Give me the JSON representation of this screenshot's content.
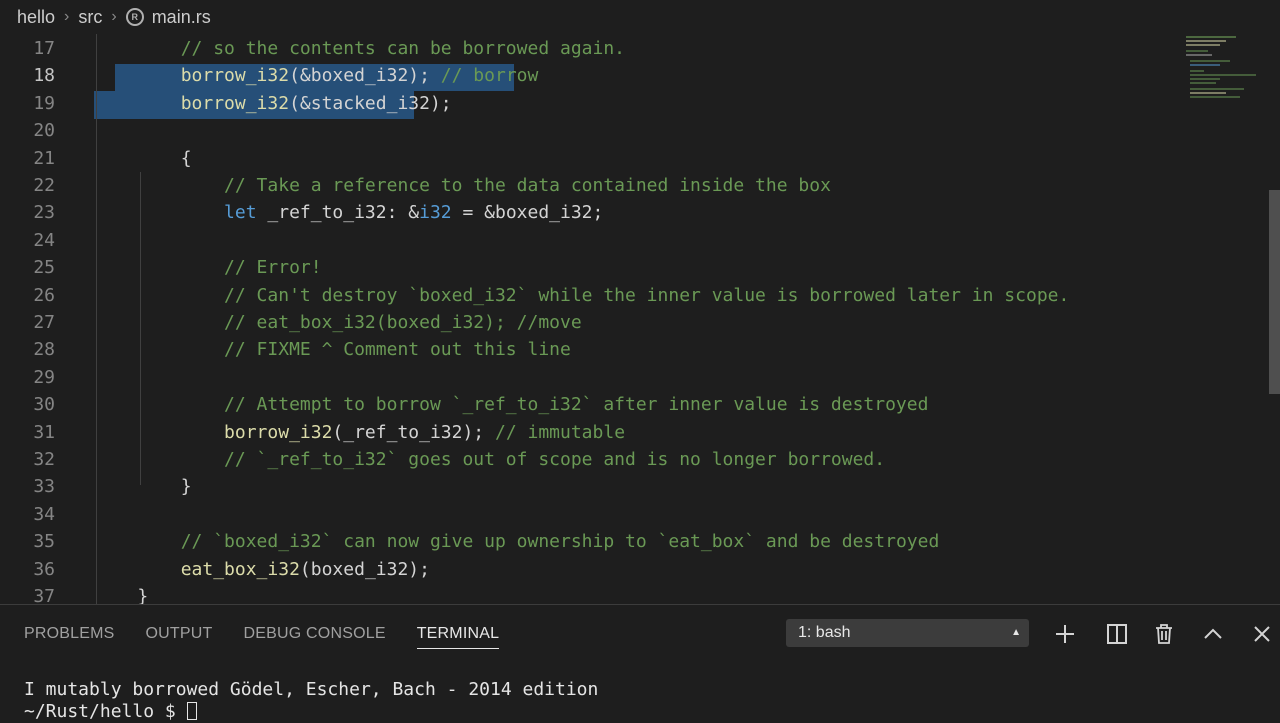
{
  "breadcrumb": {
    "items": [
      "hello",
      "src",
      "main.rs"
    ],
    "file_icon": "rust-file-icon"
  },
  "editor": {
    "active_line": "18",
    "lines": [
      {
        "num": "17",
        "tokens": [
          {
            "t": "        "
          },
          {
            "t": "// so the contents can be borrowed again.",
            "c": "comment"
          }
        ]
      },
      {
        "num": "18",
        "tokens": [
          {
            "t": "        "
          },
          {
            "t": "borrow_i32",
            "c": "fn"
          },
          {
            "t": "(&boxed_i32); "
          },
          {
            "t": "// borrow",
            "c": "comment"
          }
        ]
      },
      {
        "num": "19",
        "tokens": [
          {
            "t": "        "
          },
          {
            "t": "borrow_i32",
            "c": "fn"
          },
          {
            "t": "(&stacked_i32);"
          }
        ]
      },
      {
        "num": "20",
        "tokens": []
      },
      {
        "num": "21",
        "tokens": [
          {
            "t": "        {"
          }
        ]
      },
      {
        "num": "22",
        "tokens": [
          {
            "t": "            "
          },
          {
            "t": "// Take a reference to the data contained inside the box",
            "c": "comment"
          }
        ]
      },
      {
        "num": "23",
        "tokens": [
          {
            "t": "            "
          },
          {
            "t": "let",
            "c": "keyword"
          },
          {
            "t": " _ref_to_i32: &"
          },
          {
            "t": "i32",
            "c": "keyword"
          },
          {
            "t": " = &boxed_i32;"
          }
        ]
      },
      {
        "num": "24",
        "tokens": []
      },
      {
        "num": "25",
        "tokens": [
          {
            "t": "            "
          },
          {
            "t": "// Error!",
            "c": "comment"
          }
        ]
      },
      {
        "num": "26",
        "tokens": [
          {
            "t": "            "
          },
          {
            "t": "// Can't destroy `boxed_i32` while the inner value is borrowed later in scope.",
            "c": "comment"
          }
        ]
      },
      {
        "num": "27",
        "tokens": [
          {
            "t": "            "
          },
          {
            "t": "// eat_box_i32(boxed_i32); //move",
            "c": "comment"
          }
        ]
      },
      {
        "num": "28",
        "tokens": [
          {
            "t": "            "
          },
          {
            "t": "// FIXME ^ Comment out this line",
            "c": "comment"
          }
        ]
      },
      {
        "num": "29",
        "tokens": []
      },
      {
        "num": "30",
        "tokens": [
          {
            "t": "            "
          },
          {
            "t": "// Attempt to borrow `_ref_to_i32` after inner value is destroyed",
            "c": "comment"
          }
        ]
      },
      {
        "num": "31",
        "tokens": [
          {
            "t": "            "
          },
          {
            "t": "borrow_i32",
            "c": "fn"
          },
          {
            "t": "(_ref_to_i32); "
          },
          {
            "t": "// immutable",
            "c": "comment"
          }
        ]
      },
      {
        "num": "32",
        "tokens": [
          {
            "t": "            "
          },
          {
            "t": "// `_ref_to_i32` goes out of scope and is no longer borrowed.",
            "c": "comment"
          }
        ]
      },
      {
        "num": "33",
        "tokens": [
          {
            "t": "        }"
          }
        ]
      },
      {
        "num": "34",
        "tokens": []
      },
      {
        "num": "35",
        "tokens": [
          {
            "t": "        "
          },
          {
            "t": "// `boxed_i32` can now give up ownership to `eat_box` and be destroyed",
            "c": "comment"
          }
        ]
      },
      {
        "num": "36",
        "tokens": [
          {
            "t": "        "
          },
          {
            "t": "eat_box_i32",
            "c": "fn"
          },
          {
            "t": "(boxed_i32);"
          }
        ]
      },
      {
        "num": "37",
        "tokens": [
          {
            "t": "    }"
          }
        ]
      }
    ]
  },
  "panel": {
    "tabs": [
      "PROBLEMS",
      "OUTPUT",
      "DEBUG CONSOLE",
      "TERMINAL"
    ],
    "active_tab": "TERMINAL",
    "terminal_select": "1: bash",
    "terminal_lines": [
      "I mutably borrowed Gödel, Escher, Bach - 2014 edition",
      "~/Rust/hello $ "
    ]
  },
  "colors": {
    "background": "#1e1e1e",
    "selection": "#264f78",
    "comment": "#6a9955",
    "keyword": "#569cd6",
    "function": "#dcdcaa"
  }
}
